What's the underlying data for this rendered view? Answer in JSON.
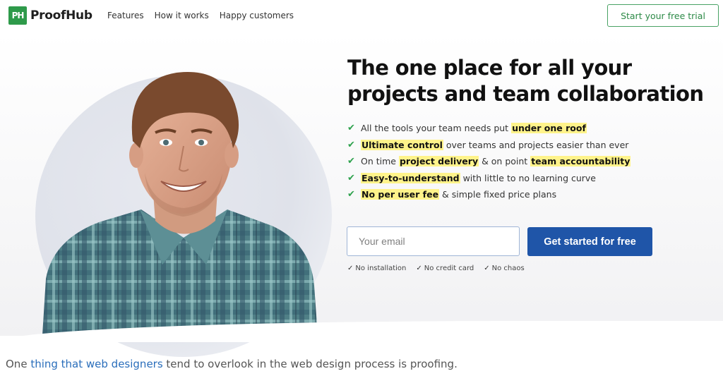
{
  "header": {
    "logo_mark": "PH",
    "logo_text": "ProofHub",
    "nav": [
      "Features",
      "How it works",
      "Happy customers"
    ],
    "trial_button": "Start your free trial"
  },
  "hero": {
    "headline_line1": "The one place for all your",
    "headline_line2": "projects and team collaboration",
    "features": [
      {
        "parts": [
          {
            "t": "All the tools your team needs put ",
            "h": false
          },
          {
            "t": "under one roof",
            "h": true
          }
        ]
      },
      {
        "parts": [
          {
            "t": "Ultimate control",
            "h": true
          },
          {
            "t": " over teams and projects easier than ever",
            "h": false
          }
        ]
      },
      {
        "parts": [
          {
            "t": "On time ",
            "h": false
          },
          {
            "t": "project delivery",
            "h": true
          },
          {
            "t": " & on point ",
            "h": false
          },
          {
            "t": "team accountability",
            "h": true
          }
        ]
      },
      {
        "parts": [
          {
            "t": "Easy-to-understand",
            "h": true
          },
          {
            "t": " with little to no learning curve",
            "h": false
          }
        ]
      },
      {
        "parts": [
          {
            "t": "No per user fee",
            "h": true
          },
          {
            "t": " & simple fixed price plans",
            "h": false
          }
        ]
      }
    ],
    "email_placeholder": "Your email",
    "cta_button": "Get started for free",
    "notes": [
      "No installation",
      "No credit card",
      "No chaos"
    ]
  },
  "caption": {
    "before": "One ",
    "link": "thing that web designers",
    "after": " tend to overlook in the web design process is proofing."
  },
  "colors": {
    "brand_green": "#2e9a4a",
    "cta_blue": "#1f55a8",
    "highlight_yellow": "#fff38a",
    "link_blue": "#2a6ebb"
  },
  "icons": [
    "check-icon",
    "person-photo"
  ]
}
